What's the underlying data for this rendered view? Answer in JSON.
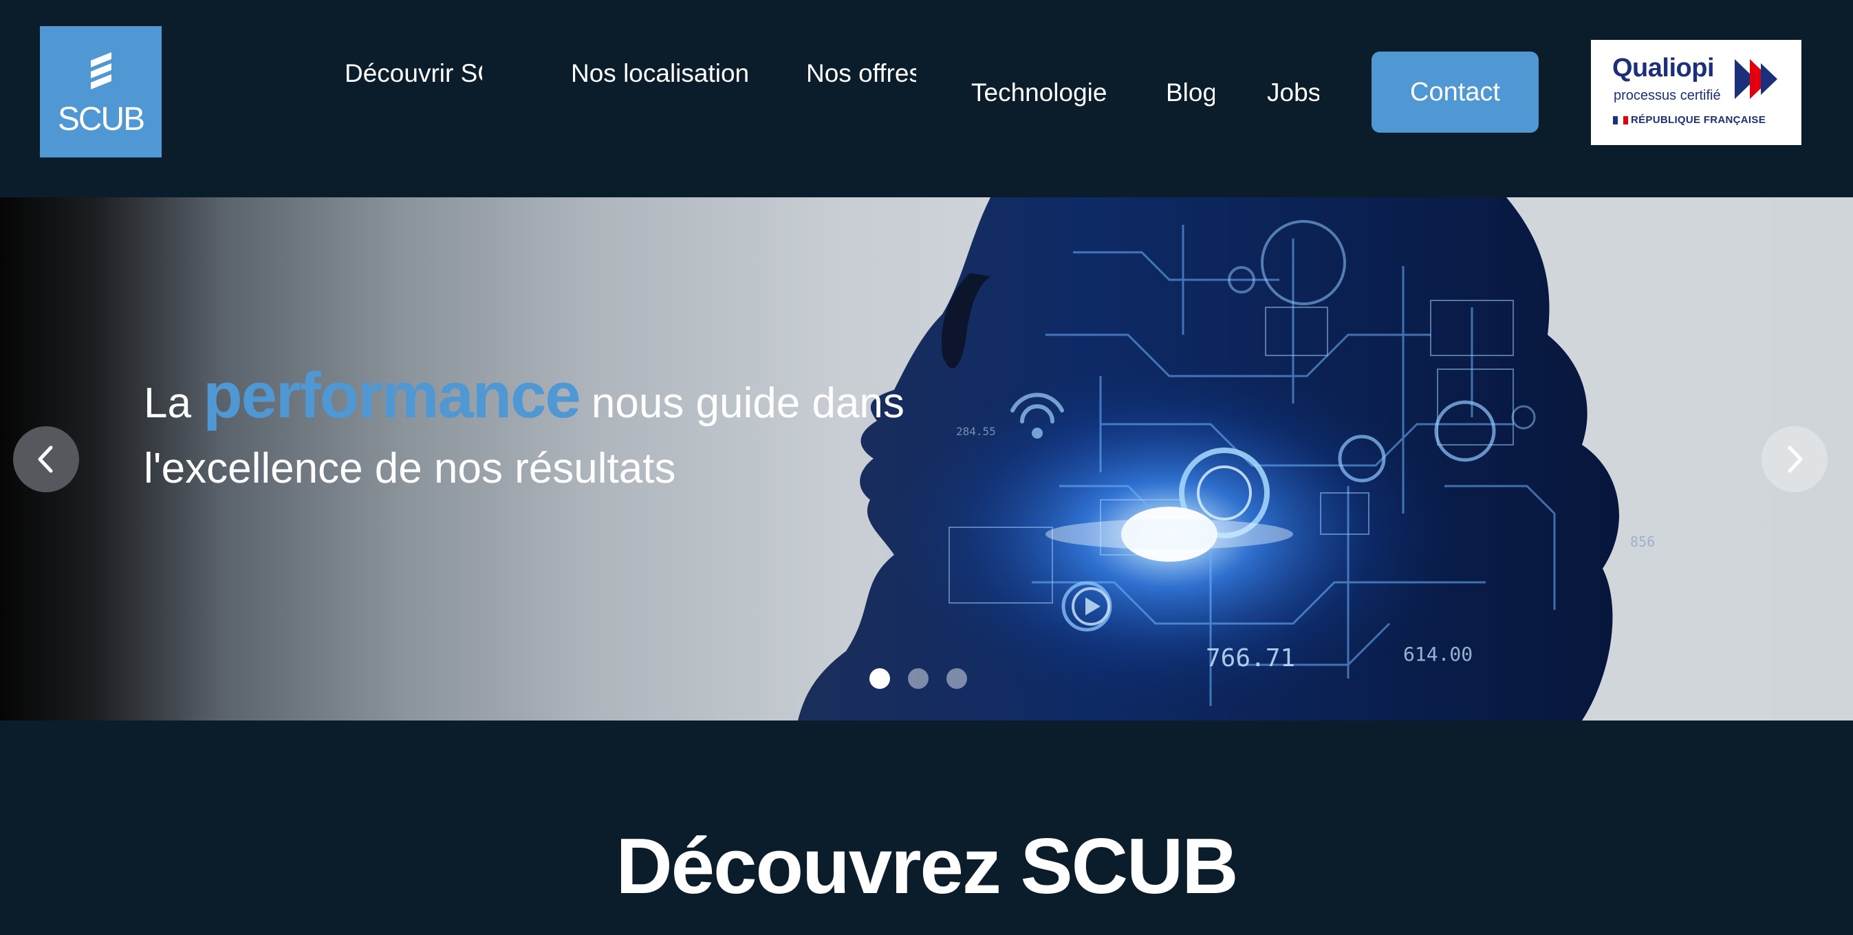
{
  "header": {
    "logo_text": "SCUB",
    "nav": [
      {
        "label": "Découvrir SCUB"
      },
      {
        "label": "Nos localisations"
      },
      {
        "label": "Nos offres"
      },
      {
        "label": "Technologie"
      },
      {
        "label": "Blog"
      },
      {
        "label": "Jobs"
      }
    ],
    "contact_label": "Contact",
    "qualiopi": {
      "title": "Qualiopi",
      "subtitle": "processus certifié",
      "republic": "RÉPUBLIQUE FRANÇAISE"
    }
  },
  "hero": {
    "line1_prefix": "La ",
    "line1_accent": "performance",
    "line1_suffix": " nous guide dans",
    "line2": "l'excellence de nos résultats",
    "numbers": [
      "766.71",
      "614.00",
      "856",
      "284.55"
    ],
    "slide_count": 3,
    "active_slide": 1
  },
  "section": {
    "title": "Découvrez SCUB"
  },
  "colors": {
    "background": "#0b1c2a",
    "accent": "#4f98d4",
    "qualiopi_blue": "#1b2f7a",
    "qualiopi_red": "#e1000f"
  }
}
